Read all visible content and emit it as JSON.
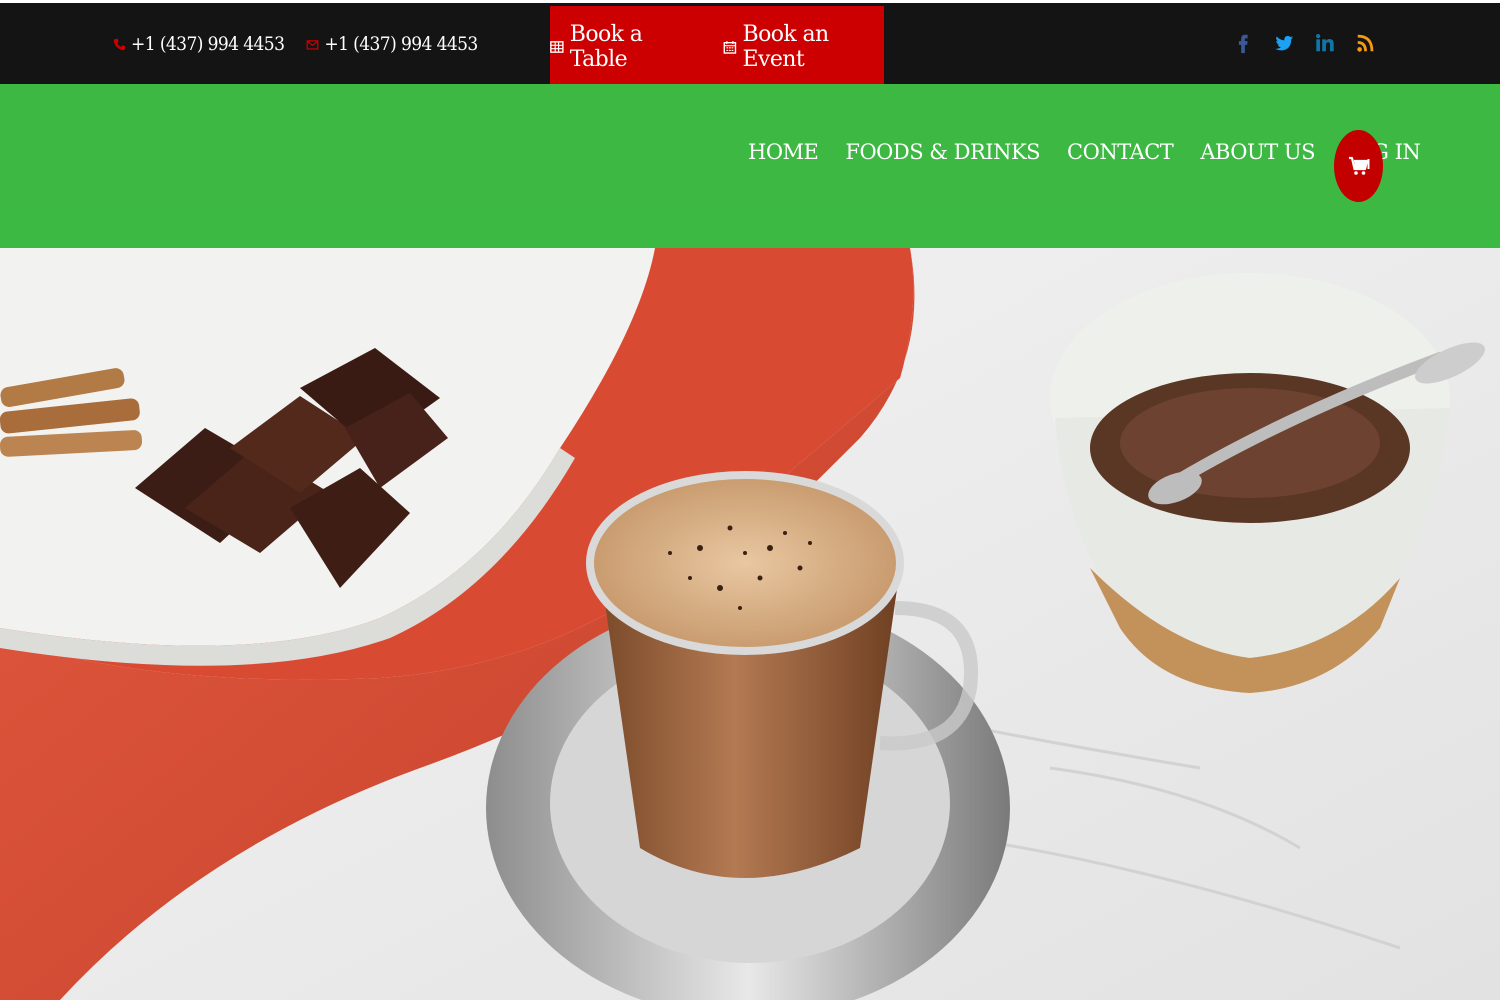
{
  "topbar": {
    "phone": "+1 (437) 994 4453",
    "email": "+1 (437) 994 4453",
    "book_table": "Book a Table",
    "book_event": "Book an Event",
    "socials": [
      {
        "name": "facebook-icon",
        "color": "#3b5998"
      },
      {
        "name": "twitter-icon",
        "color": "#1da1f2"
      },
      {
        "name": "linkedin-icon",
        "color": "#0e76a8"
      },
      {
        "name": "rss-icon",
        "color": "#f39c12"
      }
    ]
  },
  "nav": {
    "items": [
      "HOME",
      "FOODS & DRINKS",
      "CONTACT",
      "ABOUT US",
      "LOG IN"
    ]
  },
  "colors": {
    "topbar_bg": "#141414",
    "accent_red": "#cc0000",
    "nav_green": "#3cb843"
  }
}
